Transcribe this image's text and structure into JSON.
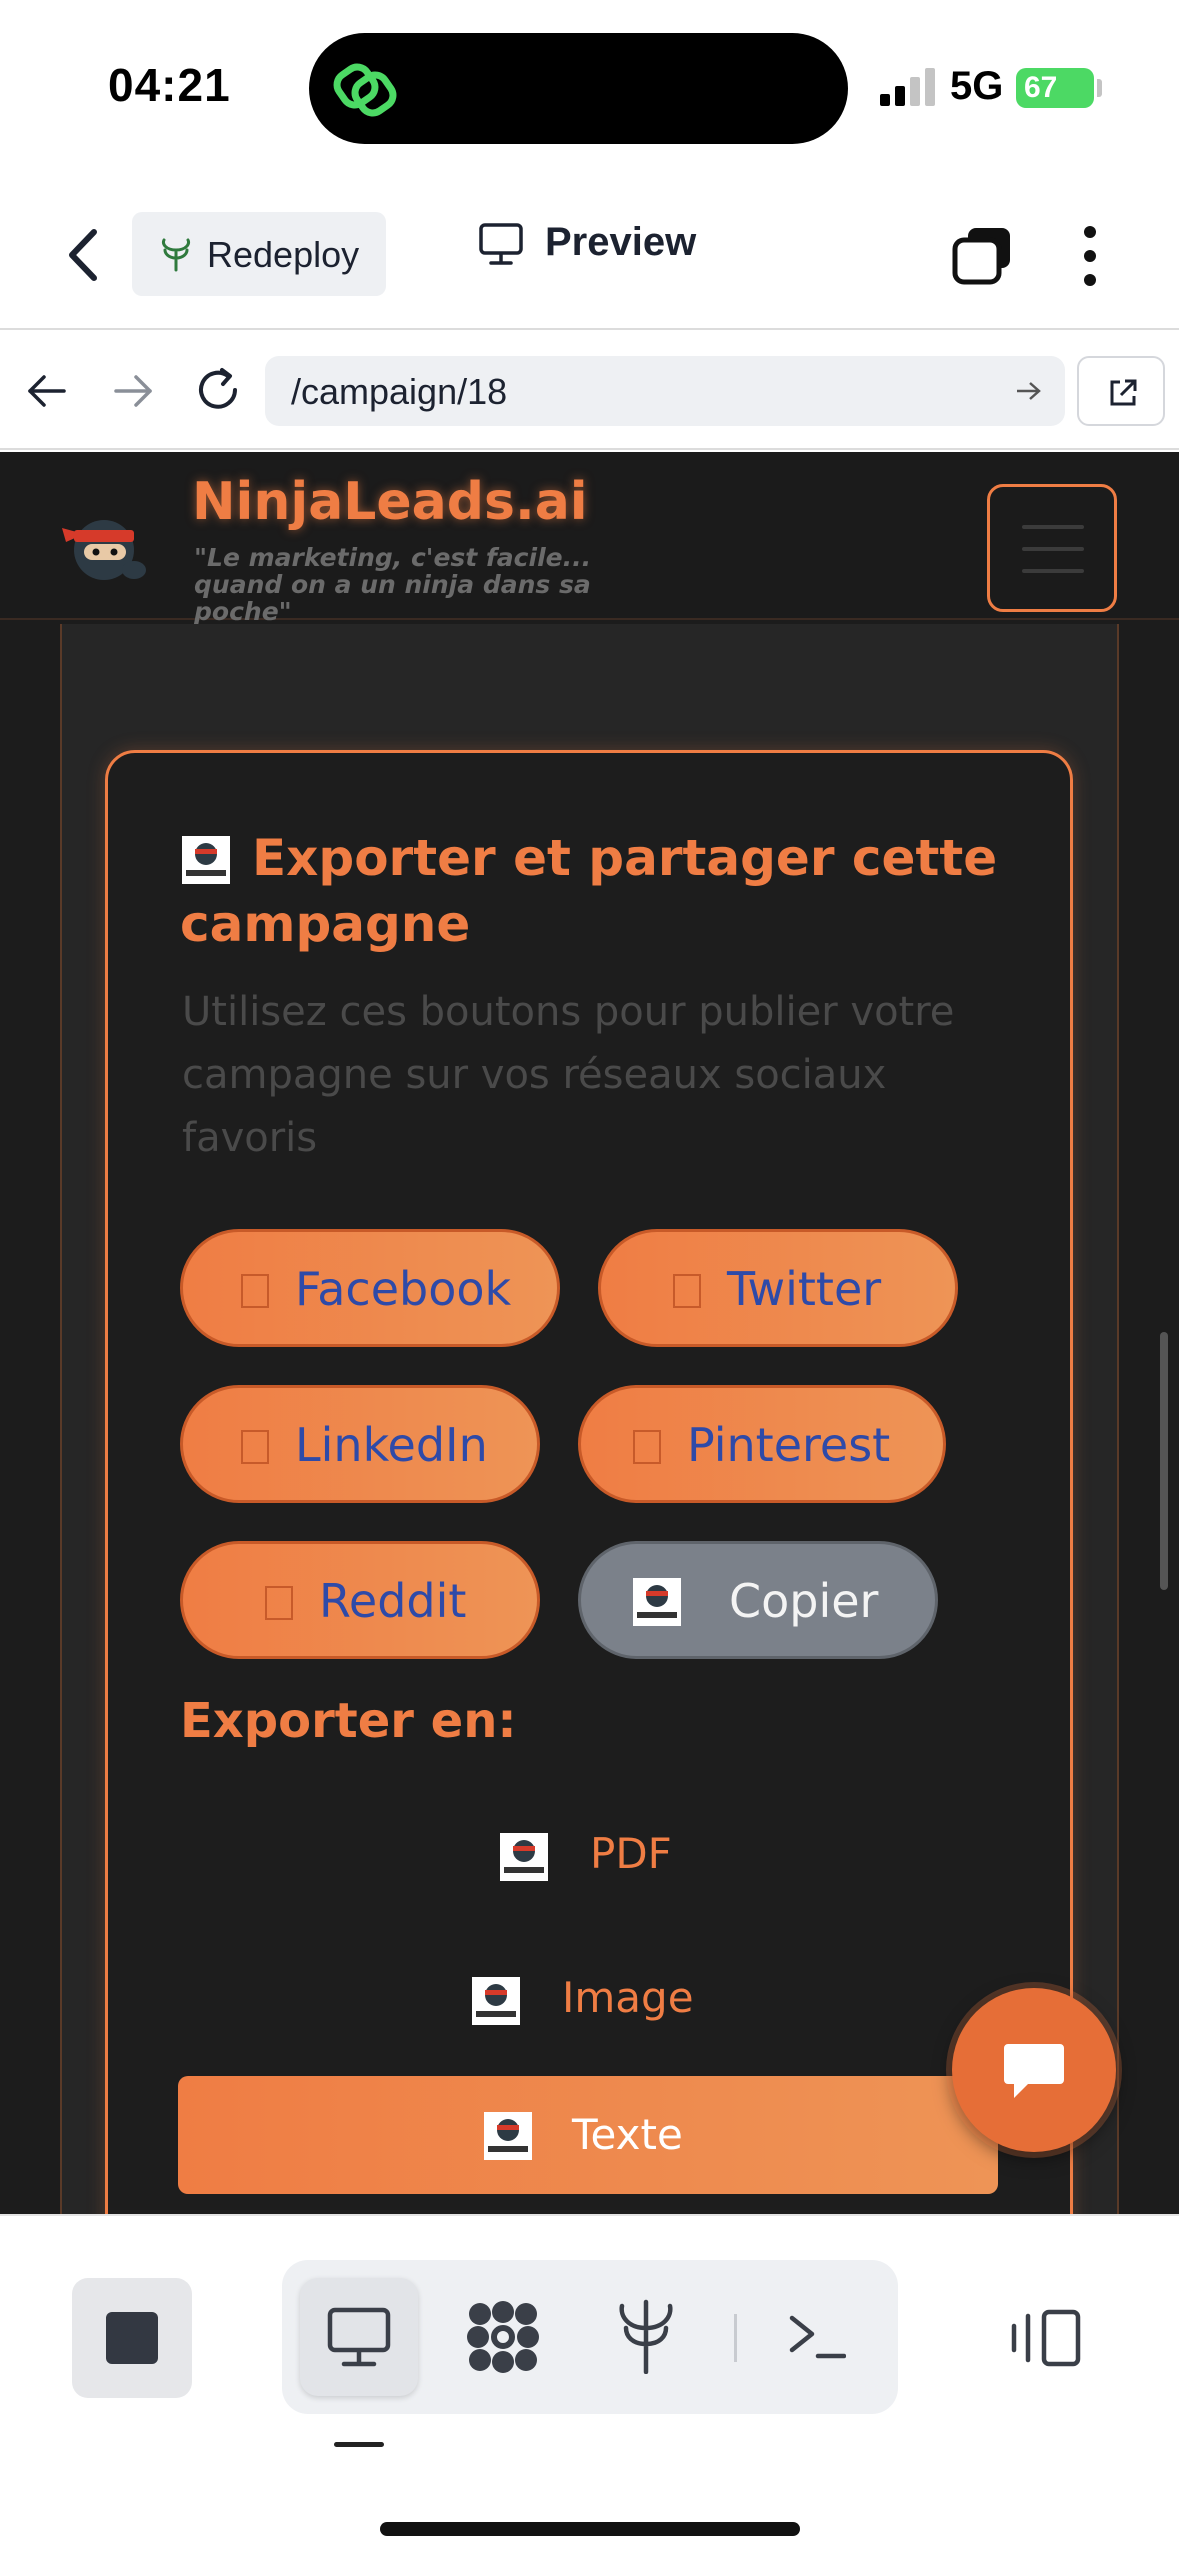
{
  "status_bar": {
    "time": "04:21",
    "network": "5G",
    "battery": "67"
  },
  "replit_bar": {
    "redeploy_label": "Redeploy",
    "preview_label": "Preview"
  },
  "url_bar": {
    "url": "/campaign/18"
  },
  "site": {
    "brand": "NinjaLeads.ai",
    "tagline": "\"Le marketing, c'est facile... quand on a un ninja dans sa poche\"",
    "accent_color": "#ef7d44"
  },
  "share_card": {
    "title": "Exporter et partager cette campagne",
    "subtitle": "Utilisez ces boutons pour publier votre campagne sur vos réseaux sociaux favoris",
    "buttons": {
      "facebook": "Facebook",
      "twitter": "Twitter",
      "linkedin": "LinkedIn",
      "pinterest": "Pinterest",
      "reddit": "Reddit",
      "copy": "Copier"
    },
    "export_title": "Exporter en:",
    "export": {
      "pdf": "PDF",
      "image": "Image",
      "text": "Texte"
    }
  },
  "icons": {
    "back": "chevron-left-icon",
    "redeploy": "deploy-tree-icon",
    "preview": "monitor-icon",
    "tabs": "tabs-icon",
    "more": "vertical-dots-icon",
    "chat": "chat-bubble-icon"
  }
}
